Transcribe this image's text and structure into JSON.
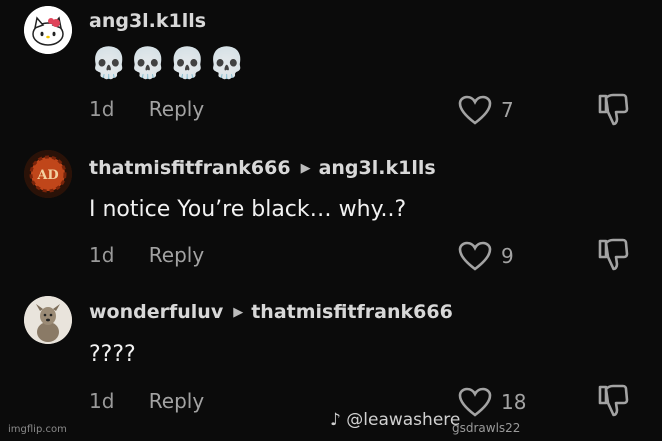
{
  "comments": [
    {
      "username": "ang3l.k1lls",
      "reply_to": "",
      "text": "💀💀💀💀",
      "time": "1d",
      "reply_label": "Reply",
      "likes": "7"
    },
    {
      "username": "thatmisfitfrank666",
      "reply_to": "ang3l.k1lls",
      "text": "I notice You’re black… why..?",
      "time": "1d",
      "reply_label": "Reply",
      "likes": "9"
    },
    {
      "username": "wonderfuluv",
      "reply_to": "thatmisfitfrank666",
      "text": "????",
      "time": "1d",
      "reply_label": "Reply",
      "likes": "18"
    }
  ],
  "watermarks": {
    "imgflip": "imgflip.com",
    "tiktok": "@leawashere",
    "tiktok_sub": "gsdrawls22"
  },
  "icons": [
    "heart-outline-icon",
    "dislike-icon",
    "triangle-right-icon",
    "tiktok-logo-icon"
  ]
}
